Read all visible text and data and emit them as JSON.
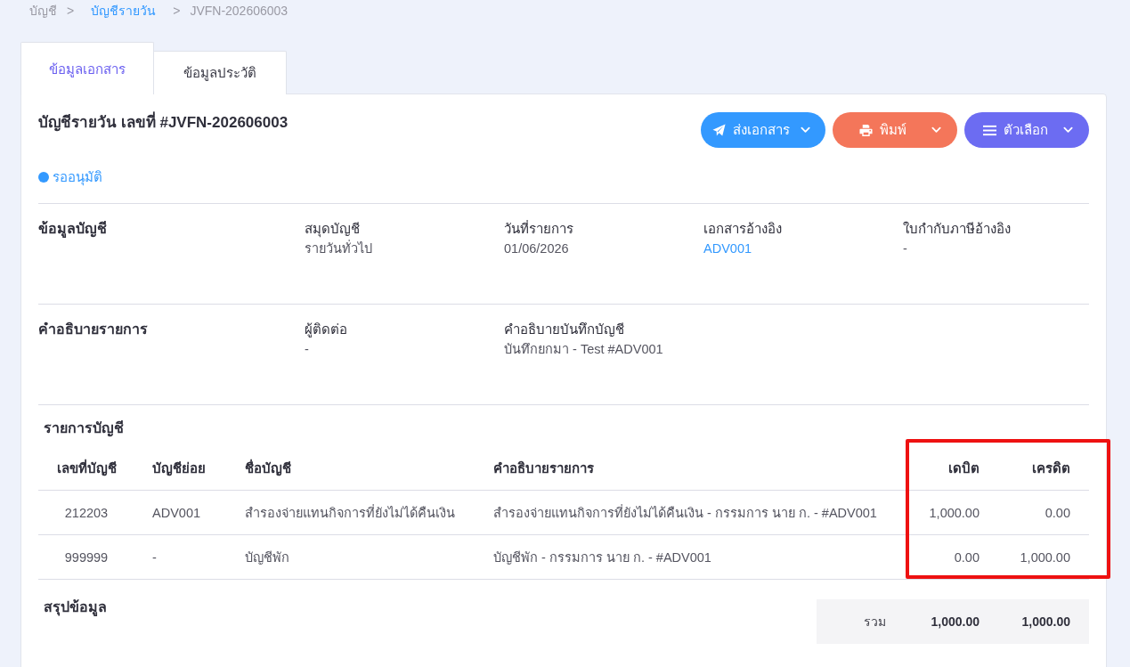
{
  "breadcrumb": [
    {
      "label": "บัญชี",
      "kind": "text"
    },
    {
      "label": ">",
      "kind": "separator"
    },
    {
      "label": "บัญชีรายวัน",
      "kind": "link"
    },
    {
      "label": ">",
      "kind": "separator"
    },
    {
      "label": "JVFN-202606003",
      "kind": "current"
    }
  ],
  "tabs": [
    {
      "label": "ข้อมูลเอกสาร",
      "selected": true
    },
    {
      "label": "ข้อมูลประวัติ",
      "selected": false
    }
  ],
  "document": {
    "title": "บัญชีรายวัน เลขที่ #JVFN-202606003",
    "status": {
      "label": "รออนุมัติ",
      "kind": "pending"
    },
    "actions": [
      {
        "label": "ส่งเอกสาร",
        "kind": "send"
      },
      {
        "label": "พิมพ์",
        "kind": "print"
      },
      {
        "label": "ตัวเลือก",
        "kind": "options"
      }
    ]
  },
  "sections": [
    {
      "heading": "ข้อมูลบัญชี",
      "fields": [
        {
          "label": "สมุดบัญชี",
          "value": "รายวันทั่วไป",
          "kind": "text"
        },
        {
          "label": "วันที่รายการ",
          "value": "01/06/2026",
          "kind": "text"
        },
        {
          "label": "เอกสารอ้างอิง",
          "value": "ADV001",
          "kind": "link"
        },
        {
          "label": "ใบกำกับภาษีอ้างอิง",
          "value": "-",
          "kind": "text"
        }
      ]
    },
    {
      "heading": "คำอธิบายรายการ",
      "fields": [
        {
          "label": "ผู้ติดต่อ",
          "value": "-",
          "kind": "text"
        },
        {
          "label": "คำอธิบายบันทึกบัญชี",
          "value": "บันทึกยกมา - Test #ADV001",
          "kind": "text"
        }
      ]
    }
  ],
  "entries": {
    "heading": "รายการบัญชี",
    "columns": [
      "เลขที่บัญชี",
      "บัญชีย่อย",
      "ชื่อบัญชี",
      "คำอธิบายรายการ",
      "เดบิต",
      "เครดิต"
    ],
    "rows": [
      [
        "212203",
        "ADV001",
        "สำรองจ่ายแทนกิจการที่ยังไม่ได้คืนเงิน",
        "สำรองจ่ายแทนกิจการที่ยังไม่ได้คืนเงิน - กรรมการ นาย ก. - #ADV001",
        "1,000.00",
        "0.00"
      ],
      [
        "999999",
        "-",
        "บัญชีพัก",
        "บัญชีพัก - กรรมการ นาย ก. - #ADV001",
        "0.00",
        "1,000.00"
      ]
    ]
  },
  "summary": {
    "heading": "สรุปข้อมูล",
    "total_label": "รวม",
    "debit": "1,000.00",
    "credit": "1,000.00"
  },
  "highlight": {
    "kind": "frame"
  }
}
